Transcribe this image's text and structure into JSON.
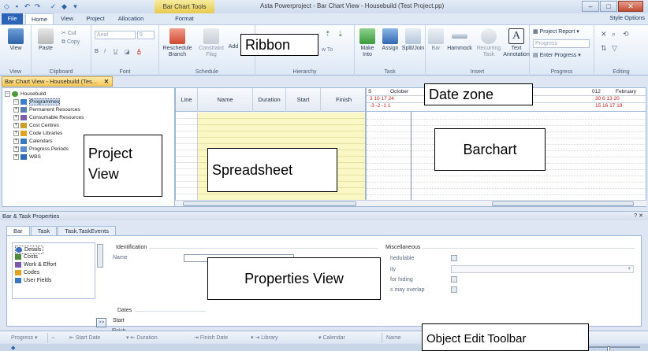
{
  "app": {
    "window_title": "Asta Powerproject - Bar Chart View - Housebuild (Test Project.pp)",
    "context_tab_header": "Bar Chart Tools"
  },
  "ribbon_tabs": {
    "file": "File",
    "home": "Home",
    "view": "View",
    "project": "Project",
    "allocation": "Allocation",
    "format": "Format",
    "style_options": "Style Options"
  },
  "ribbon": {
    "groups": {
      "view": "View",
      "clipboard": "Clipboard",
      "font": "Font",
      "schedule": "Schedule",
      "hierarchy": "Hierarchy",
      "task": "Task",
      "insert": "Insert",
      "progress": "Progress",
      "editing": "Editing"
    },
    "buttons": {
      "view": "View",
      "paste": "Paste",
      "cut": "Cut",
      "copy": "Copy",
      "font_name": "Arial",
      "font_size": "9",
      "reschedule": "Reschedule",
      "constraint_flag": "Constraint",
      "add": "Add",
      "make_into": "Make",
      "assign": "Assign",
      "split_join": "Split/Join",
      "bar": "Bar",
      "hammock": "Hammock",
      "recurring_task": "Recurring",
      "text_annotation": "Text",
      "project_report": "Project Report",
      "progress_select": "Progress",
      "enter_progress": "Enter Progress"
    },
    "button_sublabels": {
      "reschedule": "Branch",
      "constraint_flag": "Flag",
      "make_into": "Into",
      "recurring_task": "Task",
      "text_annotation": "Annotation",
      "hierarchy_sub": "w To"
    }
  },
  "callouts": {
    "ribbon": "Ribbon",
    "date_zone": "Date zone",
    "project_view": "Project View",
    "spreadsheet": "Spreadsheet",
    "barchart": "Barchart",
    "properties_view": "Properties View",
    "object_edit_toolbar": "Object Edit Toolbar"
  },
  "doc_tab": {
    "label": "Bar Chart View - Housebuild (Tes..."
  },
  "project_tree": {
    "root": "Housebuild",
    "items": [
      "Programmes",
      "Permanent Resources",
      "Consumable Resources",
      "Cost Centres",
      "Code Libraries",
      "Calendars",
      "Progress Periods",
      "WBS"
    ]
  },
  "spreadsheet": {
    "columns": [
      "Line",
      "Name",
      "Duration",
      "Start",
      "Finish"
    ]
  },
  "date_zone": {
    "left_marker": "S",
    "month_1": "October",
    "days_1": "3  10  17  24",
    "weeks_1": "-3  -2  -1  1",
    "year_2": "012",
    "month_2": "February",
    "days_2": "30  6  13  20",
    "weeks_2": "15  16  17  18"
  },
  "properties": {
    "panel_title": "Bar & Task Properties",
    "tabs": [
      "Bar",
      "Task",
      "Task.TaskEvents"
    ],
    "categories": [
      "Details",
      "Costs",
      "Work & Effort",
      "Codes",
      "User Fields"
    ],
    "identification": "Identification",
    "name_label": "Name",
    "dates_label": "Dates",
    "start_label": "Start",
    "finish_label": "Finish",
    "miscellaneous": "Miscellaneous",
    "misc_schedulable": "hedulable",
    "misc_priority": "ity",
    "misc_hiding": "for hiding",
    "misc_overlap": "s may overlap",
    "more_button": ">>"
  },
  "edit_toolbar": {
    "progress": "Progress",
    "start_date": "Start Date",
    "duration": "Duration",
    "finish_date": "Finish Date",
    "library": "Library",
    "calendar": "Calendar",
    "name": "Name"
  }
}
